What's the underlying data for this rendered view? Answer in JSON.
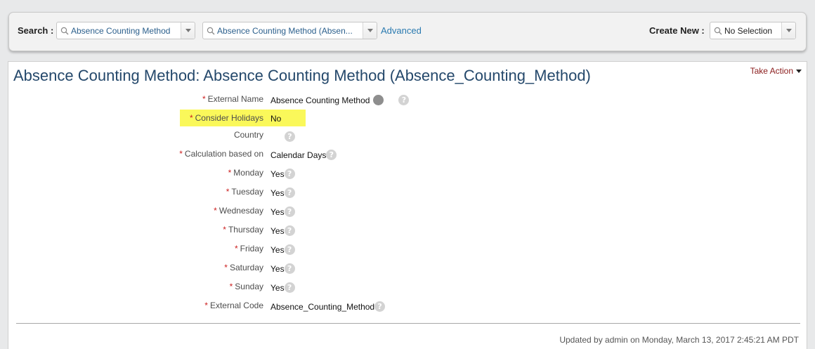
{
  "search": {
    "label": "Search :",
    "object_value": "Absence Counting Method",
    "instance_value": "Absence Counting Method (Absen...",
    "advanced_label": "Advanced"
  },
  "create_new": {
    "label": "Create New :",
    "value": "No Selection"
  },
  "page": {
    "title": "Absence Counting Method: Absence Counting Method (Absence_Counting_Method)",
    "take_action": "Take Action"
  },
  "fields": [
    {
      "label": "External Name",
      "required": "*",
      "value": "Absence Counting Method",
      "icons": [
        "translate-globe-icon",
        "help-icon"
      ]
    },
    {
      "label": "Consider Holidays",
      "required": "*",
      "value": "No",
      "icons": [],
      "highlighted": true
    },
    {
      "label": "Country",
      "required": "",
      "value": "",
      "icons": [
        "help-icon"
      ]
    },
    {
      "label": "Calculation based on",
      "required": "*",
      "value": "Calendar Days",
      "icons": [
        "help-icon"
      ]
    },
    {
      "label": "Monday",
      "required": "*",
      "value": "Yes",
      "icons": [
        "help-icon"
      ]
    },
    {
      "label": "Tuesday",
      "required": "*",
      "value": "Yes",
      "icons": [
        "help-icon"
      ]
    },
    {
      "label": "Wednesday",
      "required": "*",
      "value": "Yes",
      "icons": [
        "help-icon"
      ]
    },
    {
      "label": "Thursday",
      "required": "*",
      "value": "Yes",
      "icons": [
        "help-icon"
      ]
    },
    {
      "label": "Friday",
      "required": "*",
      "value": "Yes",
      "icons": [
        "help-icon"
      ]
    },
    {
      "label": "Saturday",
      "required": "*",
      "value": "Yes",
      "icons": [
        "help-icon"
      ]
    },
    {
      "label": "Sunday",
      "required": "*",
      "value": "Yes",
      "icons": [
        "help-icon"
      ]
    },
    {
      "label": "External Code",
      "required": "*",
      "value": "Absence_Counting_Method",
      "icons": [
        "help-icon"
      ]
    }
  ],
  "footer": {
    "updated_prefix": "Updated by",
    "updated_user": "admin",
    "updated_suffix": "on Monday, March 13, 2017 2:45:21 AM PDT"
  },
  "colors": {
    "title": "#24486b",
    "link": "#2a7ab0",
    "take_action": "#8a1b1b",
    "required": "#cc2020",
    "highlight": "#faf85a"
  },
  "help_glyph": "?"
}
